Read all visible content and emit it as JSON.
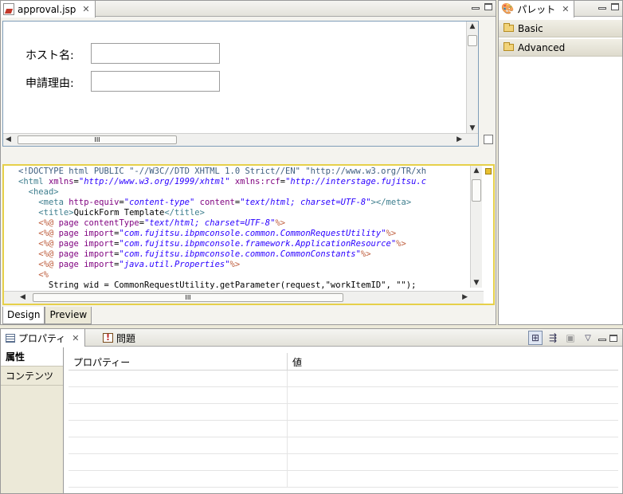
{
  "editor": {
    "tab_title": "approval.jsp",
    "form": {
      "host_label": "ホスト名:",
      "reason_label": "申請理由:"
    },
    "code_lines": [
      [
        [
          "t-doc",
          "<!DOCTYPE html PUBLIC \"-//W3C//DTD XHTML 1.0 Strict//EN\" \"http://www.w3.org/TR/xh"
        ]
      ],
      [
        [
          "t-tag",
          "<html "
        ],
        [
          "t-attr",
          "xmlns"
        ],
        [
          "t-txt",
          "="
        ],
        [
          "t-str",
          "\"http://www.w3.org/1999/xhtml\""
        ],
        [
          "t-txt",
          " "
        ],
        [
          "t-attr",
          "xmlns:rcf"
        ],
        [
          "t-txt",
          "="
        ],
        [
          "t-str",
          "\"http://interstage.fujitsu.c"
        ]
      ],
      [
        [
          "t-txt",
          "  "
        ],
        [
          "t-tag",
          "<head>"
        ]
      ],
      [
        [
          "t-txt",
          "    "
        ],
        [
          "t-tag",
          "<meta "
        ],
        [
          "t-attr",
          "http-equiv"
        ],
        [
          "t-txt",
          "="
        ],
        [
          "t-str",
          "\"content-type\""
        ],
        [
          "t-txt",
          " "
        ],
        [
          "t-attr",
          "content"
        ],
        [
          "t-txt",
          "="
        ],
        [
          "t-str",
          "\"text/html; charset=UTF-8\""
        ],
        [
          "t-tag",
          "></meta>"
        ]
      ],
      [
        [
          "t-txt",
          "    "
        ],
        [
          "t-tag",
          "<title>"
        ],
        [
          "t-txt",
          "QuickForm Template"
        ],
        [
          "t-tag",
          "</title>"
        ]
      ],
      [
        [
          "t-txt",
          "    "
        ],
        [
          "t-dir",
          "<%@ "
        ],
        [
          "t-attr",
          "page contentType"
        ],
        [
          "t-txt",
          "="
        ],
        [
          "t-str",
          "\"text/html; charset=UTF-8\""
        ],
        [
          "t-dir",
          "%>"
        ]
      ],
      [
        [
          "t-txt",
          "    "
        ],
        [
          "t-dir",
          "<%@ "
        ],
        [
          "t-attr",
          "page import"
        ],
        [
          "t-txt",
          "="
        ],
        [
          "t-str",
          "\"com.fujitsu.ibpmconsole.common.CommonRequestUtility\""
        ],
        [
          "t-dir",
          "%>"
        ]
      ],
      [
        [
          "t-txt",
          "    "
        ],
        [
          "t-dir",
          "<%@ "
        ],
        [
          "t-attr",
          "page import"
        ],
        [
          "t-txt",
          "="
        ],
        [
          "t-str",
          "\"com.fujitsu.ibpmconsole.framework.ApplicationResource\""
        ],
        [
          "t-dir",
          "%>"
        ]
      ],
      [
        [
          "t-txt",
          "    "
        ],
        [
          "t-dir",
          "<%@ "
        ],
        [
          "t-attr",
          "page import"
        ],
        [
          "t-txt",
          "="
        ],
        [
          "t-str",
          "\"com.fujitsu.ibpmconsole.common.CommonConstants\""
        ],
        [
          "t-dir",
          "%>"
        ]
      ],
      [
        [
          "t-txt",
          "    "
        ],
        [
          "t-dir",
          "<%@ "
        ],
        [
          "t-attr",
          "page import"
        ],
        [
          "t-txt",
          "="
        ],
        [
          "t-str",
          "\"java.util.Properties\""
        ],
        [
          "t-dir",
          "%>"
        ]
      ],
      [
        [
          "t-txt",
          "    "
        ],
        [
          "t-dir",
          "<%"
        ]
      ],
      [
        [
          "t-txt",
          "      String wid = CommonRequestUtility.getParameter(request,\"workItemID\", \"\");"
        ]
      ]
    ],
    "bottom_tabs": [
      "Design",
      "Preview"
    ],
    "hscroll_grip": "III"
  },
  "palette": {
    "title": "パレット",
    "drawers": [
      "Basic",
      "Advanced"
    ]
  },
  "properties": {
    "tab_title": "プロパティ",
    "problems_title": "問題",
    "categories": [
      "属性",
      "コンテンツ"
    ],
    "columns": [
      "プロパティー",
      "値"
    ]
  }
}
